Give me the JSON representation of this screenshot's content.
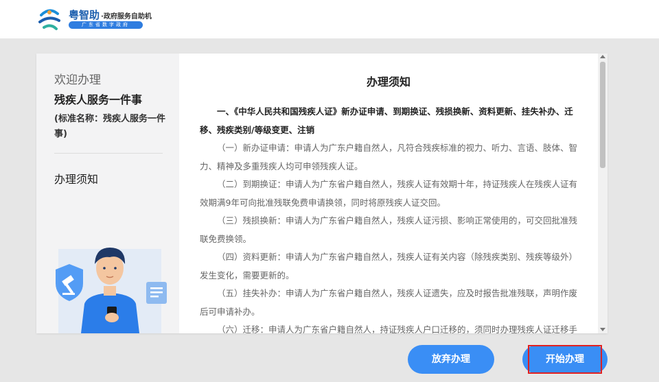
{
  "header": {
    "app_name": "粤智助",
    "app_subtitle": "·政府服务自助机",
    "org_strip": "广东省数字政府"
  },
  "sidebar": {
    "welcome": "欢迎办理",
    "service_name": "残疾人服务一件事",
    "standard_name": "(标准名称：残疾人服务一件事)",
    "current_step": "办理须知"
  },
  "content": {
    "title": "办理须知",
    "paragraphs": [
      "一、《中华人民共和国残疾人证》新办证申请、到期换证、残损换新、资料更新、挂失补办、迁移、残疾类别/等级变更、注销",
      "（一）新办证申请：申请人为广东户籍自然人，凡符合残疾标准的视力、听力、言语、肢体、智力、精神及多重残疾人均可申领残疾人证。",
      "（二）到期换证：申请人为广东省户籍自然人，残疾人证有效期十年，持证残疾人在残疾人证有效期满9年可向批准残联免费申请换领，同时将原残疾人证交回。",
      "（三）残损换新：申请人为广东省户籍自然人，残疾人证污损、影响正常使用的，可交回批准残联免费换领。",
      "（四）资料更新：申请人为广东省户籍自然人，残疾人证有关内容（除残疾类别、残疾等级外）发生变化，需要更新的。",
      "（五）挂失补办：申请人为广东省户籍自然人，残疾人证遗失，应及时报告批准残联，声明作废后可申请补办。",
      "（六）迁移：申请人为广东省户籍自然人，持证残疾人户口迁移的，须同时办理残疾人证迁移手续。"
    ]
  },
  "buttons": {
    "abandon": "放弃办理",
    "start": "开始办理"
  },
  "colors": {
    "primary_button": "#3a8ef5",
    "highlight": "#e02020",
    "brand_blue": "#1c5fae"
  },
  "icons": {
    "logo": "yue-logo-icon",
    "shield": "gavel-shield-icon",
    "document": "document-icon",
    "person": "person-with-phone-icon"
  }
}
